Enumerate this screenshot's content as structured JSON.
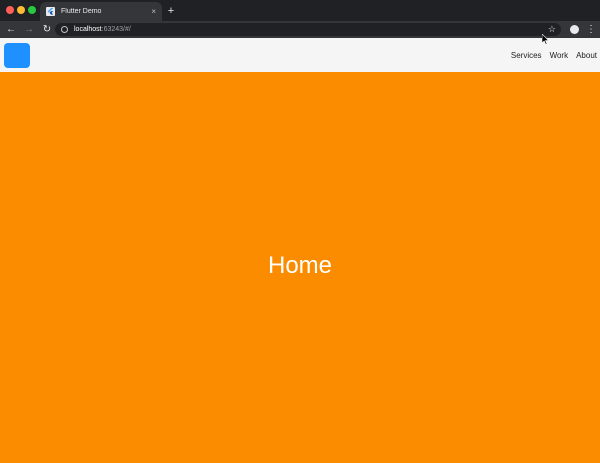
{
  "browser": {
    "tab": {
      "title": "Flutter Demo",
      "close_glyph": "×"
    },
    "new_tab_glyph": "+",
    "nav": {
      "back": "←",
      "forward": "→",
      "reload": "↻"
    },
    "url": {
      "host": "localhost",
      "rest": ":63243/#/"
    },
    "star_glyph": "☆",
    "menu_glyph": "⋮"
  },
  "app": {
    "nav_links": [
      {
        "label": "Services"
      },
      {
        "label": "Work"
      },
      {
        "label": "About"
      }
    ],
    "hero_title": "Home",
    "colors": {
      "logo": "#1e90ff",
      "hero_background": "#fb8c00",
      "app_bar": "#f5f5f5"
    }
  }
}
